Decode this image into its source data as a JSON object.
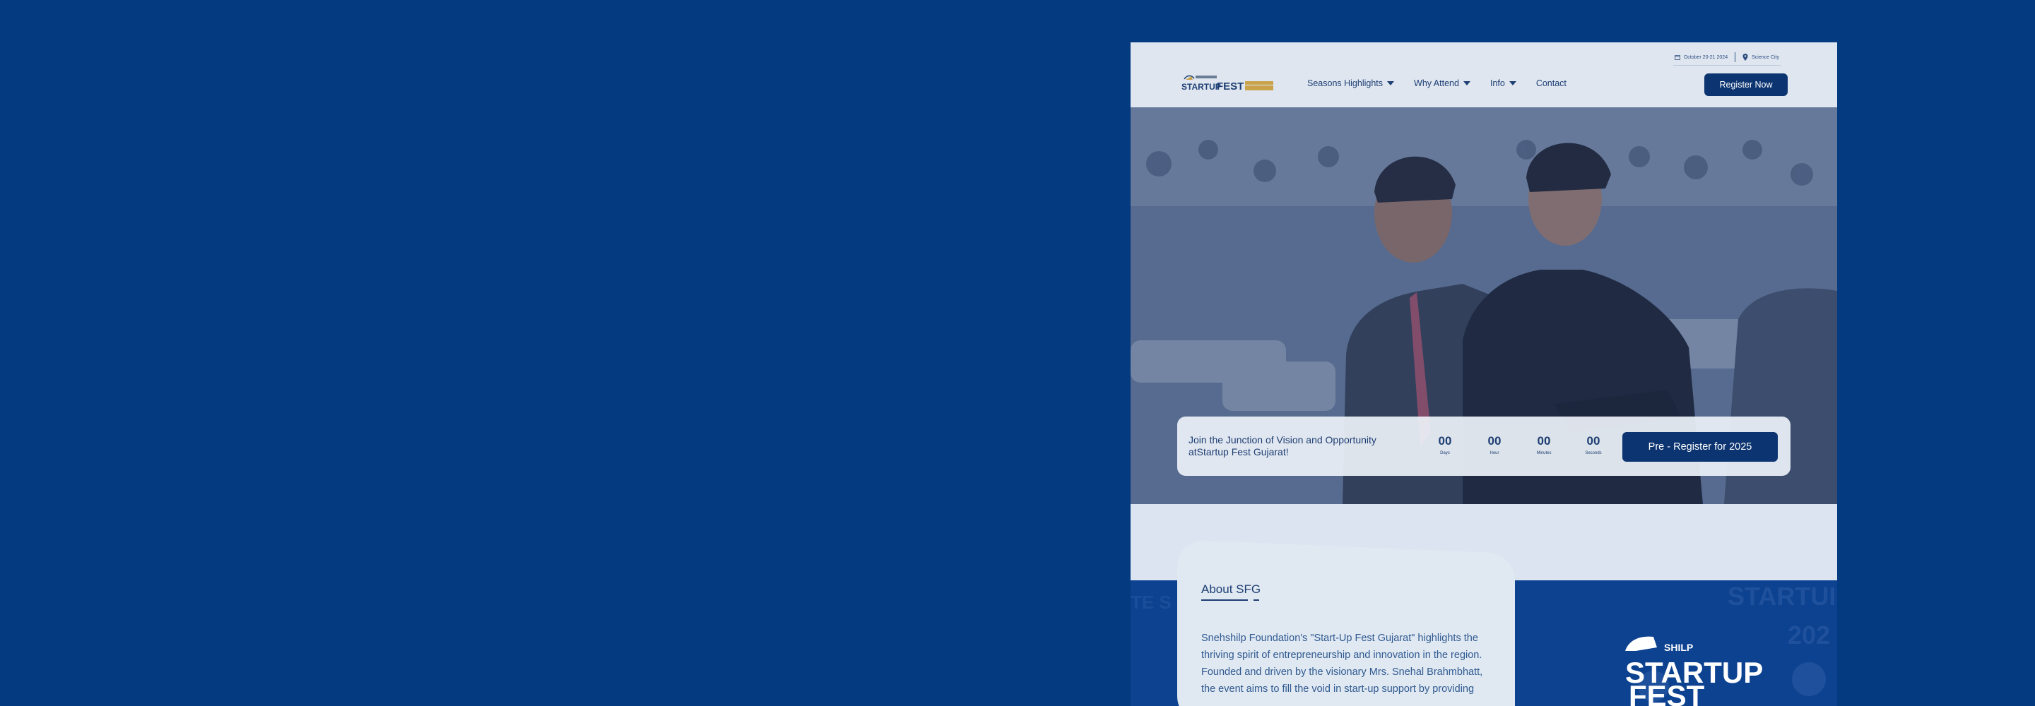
{
  "header": {
    "date_text": "October 20-21 2024",
    "location_text": "Science City",
    "logo_brand": "STARTUPFEST",
    "nav": [
      {
        "label": "Seasons Highlights",
        "has_dropdown": true
      },
      {
        "label": "Why Attend",
        "has_dropdown": true
      },
      {
        "label": "Info",
        "has_dropdown": true
      },
      {
        "label": "Contact",
        "has_dropdown": false
      }
    ],
    "register_label": "Register Now"
  },
  "hero": {
    "cta_text": "Join the Junction of Vision and Opportunity atStartup Fest Gujarat!",
    "countdown": [
      {
        "value": "00",
        "label": "Days"
      },
      {
        "value": "00",
        "label": "Hour"
      },
      {
        "value": "00",
        "label": "Minutes"
      },
      {
        "value": "00",
        "label": "Seconds"
      }
    ],
    "pre_register_label": "Pre - Register for 2025"
  },
  "about": {
    "title": "About SFG",
    "body": "Snehshilp Foundation's \"Start-Up Fest Gujarat\" highlights the thriving spirit of entrepreneurship and innovation in the region. Founded and driven by the visionary Mrs. Snehal Brahmbhatt, the event aims to fill the void in start-up support by providing"
  },
  "colors": {
    "background": "#033a80",
    "primary": "#0c3470",
    "page_bg": "#dbe4f0"
  }
}
